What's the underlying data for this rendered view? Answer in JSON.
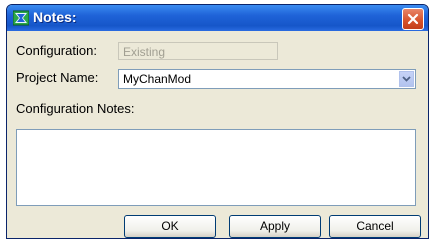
{
  "window": {
    "title": "Notes:"
  },
  "form": {
    "configuration_label": "Configuration:",
    "configuration_value": "Existing",
    "project_name_label": "Project Name:",
    "project_name_value": "MyChanMod",
    "notes_label": "Configuration Notes:",
    "notes_value": ""
  },
  "buttons": {
    "ok": "OK",
    "apply": "Apply",
    "cancel": "Cancel"
  },
  "icons": {
    "app": "notes-app-icon",
    "close": "close-icon",
    "dropdown": "chevron-down-icon"
  },
  "colors": {
    "titlebar": "#1f63d8",
    "close": "#d6512a",
    "dialog_bg": "#ece9d8",
    "field_border": "#7f9db9"
  }
}
